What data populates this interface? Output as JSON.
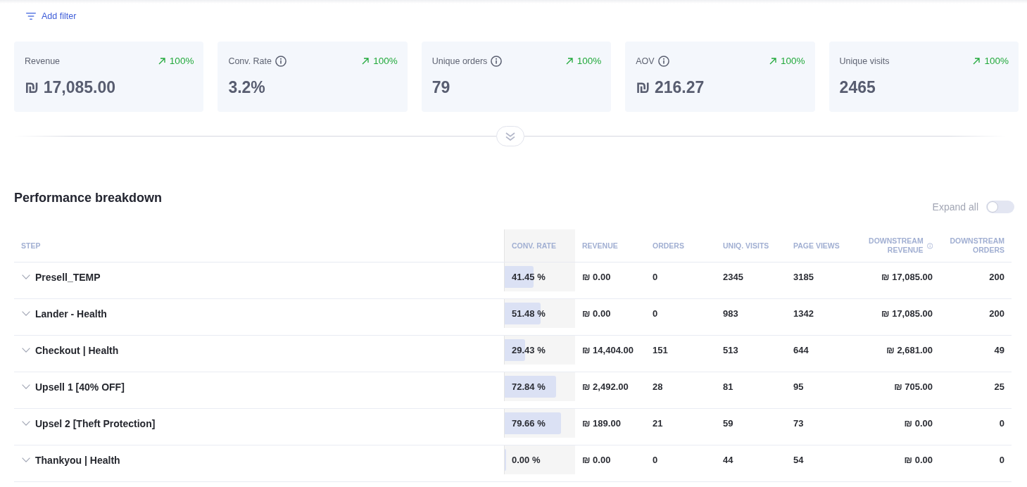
{
  "filter_bar": {
    "add_filter": "Add filter"
  },
  "kpis": [
    {
      "label": "Revenue",
      "info": false,
      "change": "100%",
      "increase": true,
      "value": "₪ 17,085.00"
    },
    {
      "label": "Conv. Rate",
      "info": true,
      "change": "100%",
      "increase": true,
      "value": "3.2%"
    },
    {
      "label": "Unique orders",
      "info": true,
      "change": "100%",
      "increase": true,
      "value": "79"
    },
    {
      "label": "AOV",
      "info": true,
      "change": "100%",
      "increase": true,
      "value": "₪ 216.27"
    },
    {
      "label": "Unique visits",
      "info": false,
      "change": "100%",
      "increase": true,
      "value": "2465"
    }
  ],
  "breakdown": {
    "title": "Performance breakdown",
    "expand_all": {
      "label": "Expand all",
      "on": false
    }
  },
  "table": {
    "columns": [
      {
        "label": "STEP",
        "info": false,
        "highlighted": false
      },
      {
        "label": "CONV. RATE",
        "info": false,
        "highlighted": true
      },
      {
        "label": "REVENUE",
        "info": false,
        "highlighted": false
      },
      {
        "label": "ORDERS",
        "info": false,
        "highlighted": false
      },
      {
        "label": "UNIQ. VISITS",
        "info": false,
        "highlighted": false
      },
      {
        "label": "PAGE VIEWS",
        "info": false,
        "highlighted": false
      },
      {
        "label": "DOWNSTREAM REVENUE",
        "info": true,
        "highlighted": false
      },
      {
        "label": "DOWNSTREAM ORDERS",
        "info": false,
        "highlighted": false
      }
    ],
    "rows": [
      {
        "step": "Presell_TEMP",
        "expanded": false,
        "conv_rate": "41.45 %",
        "level": 0.4145,
        "revenue": "₪ 0.00",
        "orders": "0",
        "uniq_visits": "2345",
        "page_views": "3185",
        "downstream_revenue": "₪ 17,085.00",
        "downstream_orders": "200"
      },
      {
        "step": "Lander - Health",
        "expanded": false,
        "conv_rate": "51.48 %",
        "level": 0.5148,
        "revenue": "₪ 0.00",
        "orders": "0",
        "uniq_visits": "983",
        "page_views": "1342",
        "downstream_revenue": "₪ 17,085.00",
        "downstream_orders": "200"
      },
      {
        "step": "Checkout | Health",
        "expanded": false,
        "conv_rate": "29.43 %",
        "level": 0.2943,
        "revenue": "₪ 14,404.00",
        "orders": "151",
        "uniq_visits": "513",
        "page_views": "644",
        "downstream_revenue": "₪ 2,681.00",
        "downstream_orders": "49"
      },
      {
        "step": "Upsell 1 [40% OFF]",
        "expanded": false,
        "conv_rate": "72.84 %",
        "level": 0.7284,
        "revenue": "₪ 2,492.00",
        "orders": "28",
        "uniq_visits": "81",
        "page_views": "95",
        "downstream_revenue": "₪ 705.00",
        "downstream_orders": "25"
      },
      {
        "step": "Upsel 2 [Theft Protection]",
        "expanded": false,
        "conv_rate": "79.66 %",
        "level": 0.7966,
        "revenue": "₪ 189.00",
        "orders": "21",
        "uniq_visits": "59",
        "page_views": "73",
        "downstream_revenue": "₪ 0.00",
        "downstream_orders": "0"
      },
      {
        "step": "Thankyou | Health",
        "expanded": false,
        "conv_rate": "0.00 %",
        "level": 0,
        "revenue": "₪ 0.00",
        "orders": "0",
        "uniq_visits": "44",
        "page_views": "54",
        "downstream_revenue": "₪ 0.00",
        "downstream_orders": "0"
      }
    ]
  }
}
